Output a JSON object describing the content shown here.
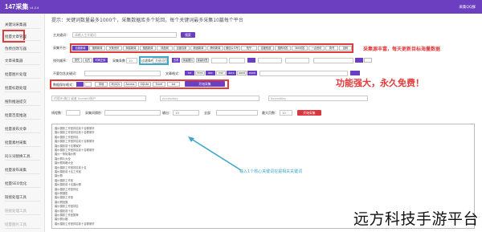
{
  "app": {
    "name": "147采集",
    "version": "v1.2.4",
    "user_link": "采集QQ群"
  },
  "sidebar": {
    "items": [
      {
        "label": "关键词采集器"
      },
      {
        "label": "批量文章管理"
      },
      {
        "label": "伪原创改写器"
      },
      {
        "label": "文章采集器"
      },
      {
        "label": "批量图片处理"
      },
      {
        "label": "批量标题处理"
      },
      {
        "label": "搜狗推送提交"
      },
      {
        "label": "批量百度推送"
      },
      {
        "label": "批量发布文章"
      },
      {
        "label": "批量素材采集"
      },
      {
        "label": "同义词替换工具"
      },
      {
        "label": "批量发布采集"
      },
      {
        "label": "批量SEO优化"
      },
      {
        "label": "链接处理工具"
      },
      {
        "label": "链接处理工具"
      },
      {
        "label": "批量图片工具"
      }
    ]
  },
  "hint": "提示：关键词数量最多1000个，采集数据库多个轮回，每个关键词最多采集10篇每个平台",
  "form": {
    "keyword_label": "主关键词：",
    "keyword_value": "请输入主关键词",
    "keyword_button": "搜索",
    "platform_label": "采集平台：",
    "platforms": [
      "百度新闻",
      "搜狗新闻",
      "头条资讯",
      "网易新闻",
      "搜狐新闻",
      "凤凰网",
      "百度百家",
      "新浪新闻",
      "腾讯新闻",
      "微信公众号",
      "知乎",
      "百度知道",
      "搜狗问答",
      "360问答",
      "一点资讯",
      "简书",
      "百科"
    ],
    "opt_label": "排列顺序：",
    "opt_values": [
      "按先",
      "后先",
      "时间正序"
    ],
    "count_label": "采集条数",
    "count_value": "10",
    "filter_label": "过滤条件",
    "filter_value": "关键词匹配",
    "extra_chips": [
      "去重",
      "保留图片",
      "保留标签"
    ],
    "exclude_label": "不要包含关键词：",
    "format_label": "文章格式：",
    "format_values": [
      "txt",
      "html",
      "doc",
      "md",
      "docx",
      "word",
      "excel"
    ],
    "save_label": "数据保存格式：",
    "save_values": [
      "本地",
      "MySQL",
      "Access",
      "SQLite",
      "Excel",
      "txt"
    ],
    "save_button": "开始采集",
    "proxy_label": "代理：",
    "proxy_placeholder": "代理IP:端口 或者 Socket5账户",
    "access_placeholder": "AccessKey",
    "secret_placeholder": "SecretKey",
    "thread_label": "线程数：",
    "interval_label": "采集间隔秒：",
    "interval_value": "10",
    "output_label": "输出：",
    "output_value": "全部",
    "pages_label": "最大页数：",
    "pages_value": "10",
    "start_button": "开始采集"
  },
  "keywords": [
    "婚纱摄影工作室排名前十名哪家好",
    "婚纱摄影工作室排名前十名哪家好",
    "婚纱摄影工作室排名",
    "婚纱摄影工作室排名前十名哪家好",
    "婚纱摄影前十名哪家好",
    "婚纱摄影工作室排名前十名哪家好",
    "婚纱一条街婚纱照",
    "婚纱照片大全",
    "婚纱照风格大全",
    "婚纱摄影工作室排名前十名",
    "婚纱摄影前十名工作室",
    "婚纱照",
    "婚纱摄影工作室",
    "婚纱摄影前十名婚纱照",
    "婚纱摄影工作室排名",
    "婚纱照摄影",
    "婚纱摄影工作室",
    "婚纱照拍摄",
    "婚纱摄影工作室排名",
    "婚纱摄影前十名",
    "婚纱摄影工作室推荐",
    "婚纱照价格",
    "婚纱摄影工作室排名前十名哪家好"
  ],
  "annotations": {
    "red_top": "采集源丰富，每天更新目标海量数据",
    "red_mid": "功能强大，永久免费！",
    "blue": "输入1个核心关键词挖掘相关关键词"
  },
  "watermark": "远方科技手游平台",
  "colors": {
    "accent": "#6b3fbf",
    "annotation_red": "#e23b3b",
    "annotation_blue": "#3fa7c9"
  }
}
